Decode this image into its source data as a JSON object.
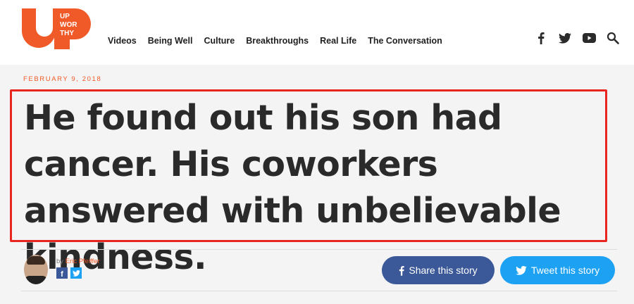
{
  "header": {
    "logo_text": [
      "UP",
      "WOR",
      "THY"
    ],
    "nav": [
      "Videos",
      "Being Well",
      "Culture",
      "Breakthroughs",
      "Real Life",
      "The Conversation"
    ],
    "social_icons": [
      "facebook-icon",
      "twitter-icon",
      "youtube-icon",
      "search-icon"
    ]
  },
  "article": {
    "date": "FEBRUARY 9, 2018",
    "headline": "He found out his son had cancer. His coworkers answered with unbelievable kindness.",
    "byline_prefix": "by",
    "author_name": "Eric Pfeiffer",
    "share_facebook": "Share this story",
    "share_twitter": "Tweet this story"
  },
  "colors": {
    "brand_orange": "#f05a28",
    "highlight_red": "#e8261f",
    "facebook_blue": "#3b5998",
    "twitter_blue": "#1da1f2",
    "article_bg": "#f4f4f4"
  }
}
